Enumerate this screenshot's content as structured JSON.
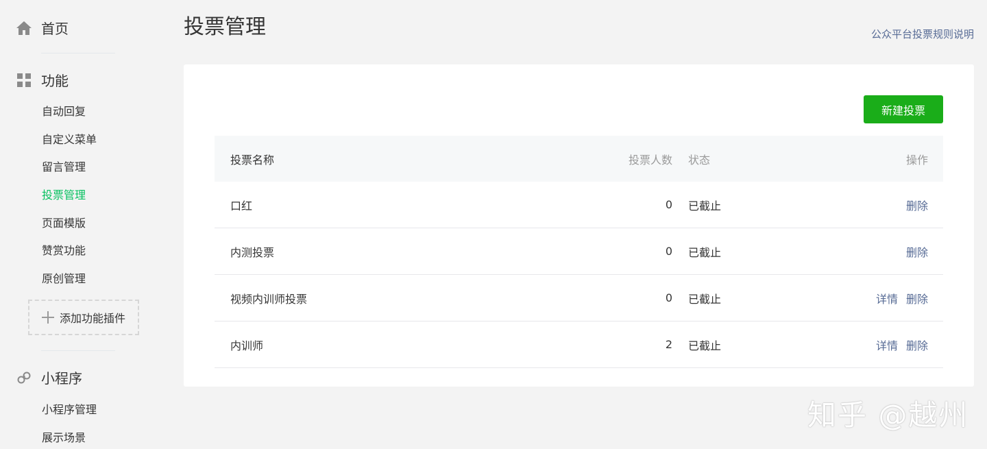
{
  "sidebar": {
    "home": {
      "label": "首页",
      "icon": "home-icon"
    },
    "features": {
      "label": "功能",
      "icon": "grid-icon",
      "items": [
        {
          "label": "自动回复",
          "active": false
        },
        {
          "label": "自定义菜单",
          "active": false
        },
        {
          "label": "留言管理",
          "active": false
        },
        {
          "label": "投票管理",
          "active": true
        },
        {
          "label": "页面模版",
          "active": false
        },
        {
          "label": "赞赏功能",
          "active": false
        },
        {
          "label": "原创管理",
          "active": false
        }
      ],
      "add_plugin": "添加功能插件"
    },
    "miniprogram": {
      "label": "小程序",
      "icon": "link-icon",
      "items": [
        {
          "label": "小程序管理"
        },
        {
          "label": "展示场景"
        }
      ]
    }
  },
  "header": {
    "title": "投票管理",
    "rules_link": "公众平台投票规则说明"
  },
  "main": {
    "new_button": "新建投票",
    "table": {
      "columns": {
        "name": "投票名称",
        "count": "投票人数",
        "status": "状态",
        "ops": "操作"
      },
      "rows": [
        {
          "name": "口红",
          "count": "0",
          "status": "已截止",
          "detail": "",
          "delete": "删除"
        },
        {
          "name": "内测投票",
          "count": "0",
          "status": "已截止",
          "detail": "",
          "delete": "删除"
        },
        {
          "name": "视频内训师投票",
          "count": "0",
          "status": "已截止",
          "detail": "详情",
          "delete": "删除"
        },
        {
          "name": "内训师",
          "count": "2",
          "status": "已截止",
          "detail": "详情",
          "delete": "删除"
        }
      ]
    }
  },
  "watermark": "知乎 @越州",
  "colors": {
    "accent_green": "#07c160",
    "button_green": "#1aad19",
    "link_blue": "#576b95"
  }
}
